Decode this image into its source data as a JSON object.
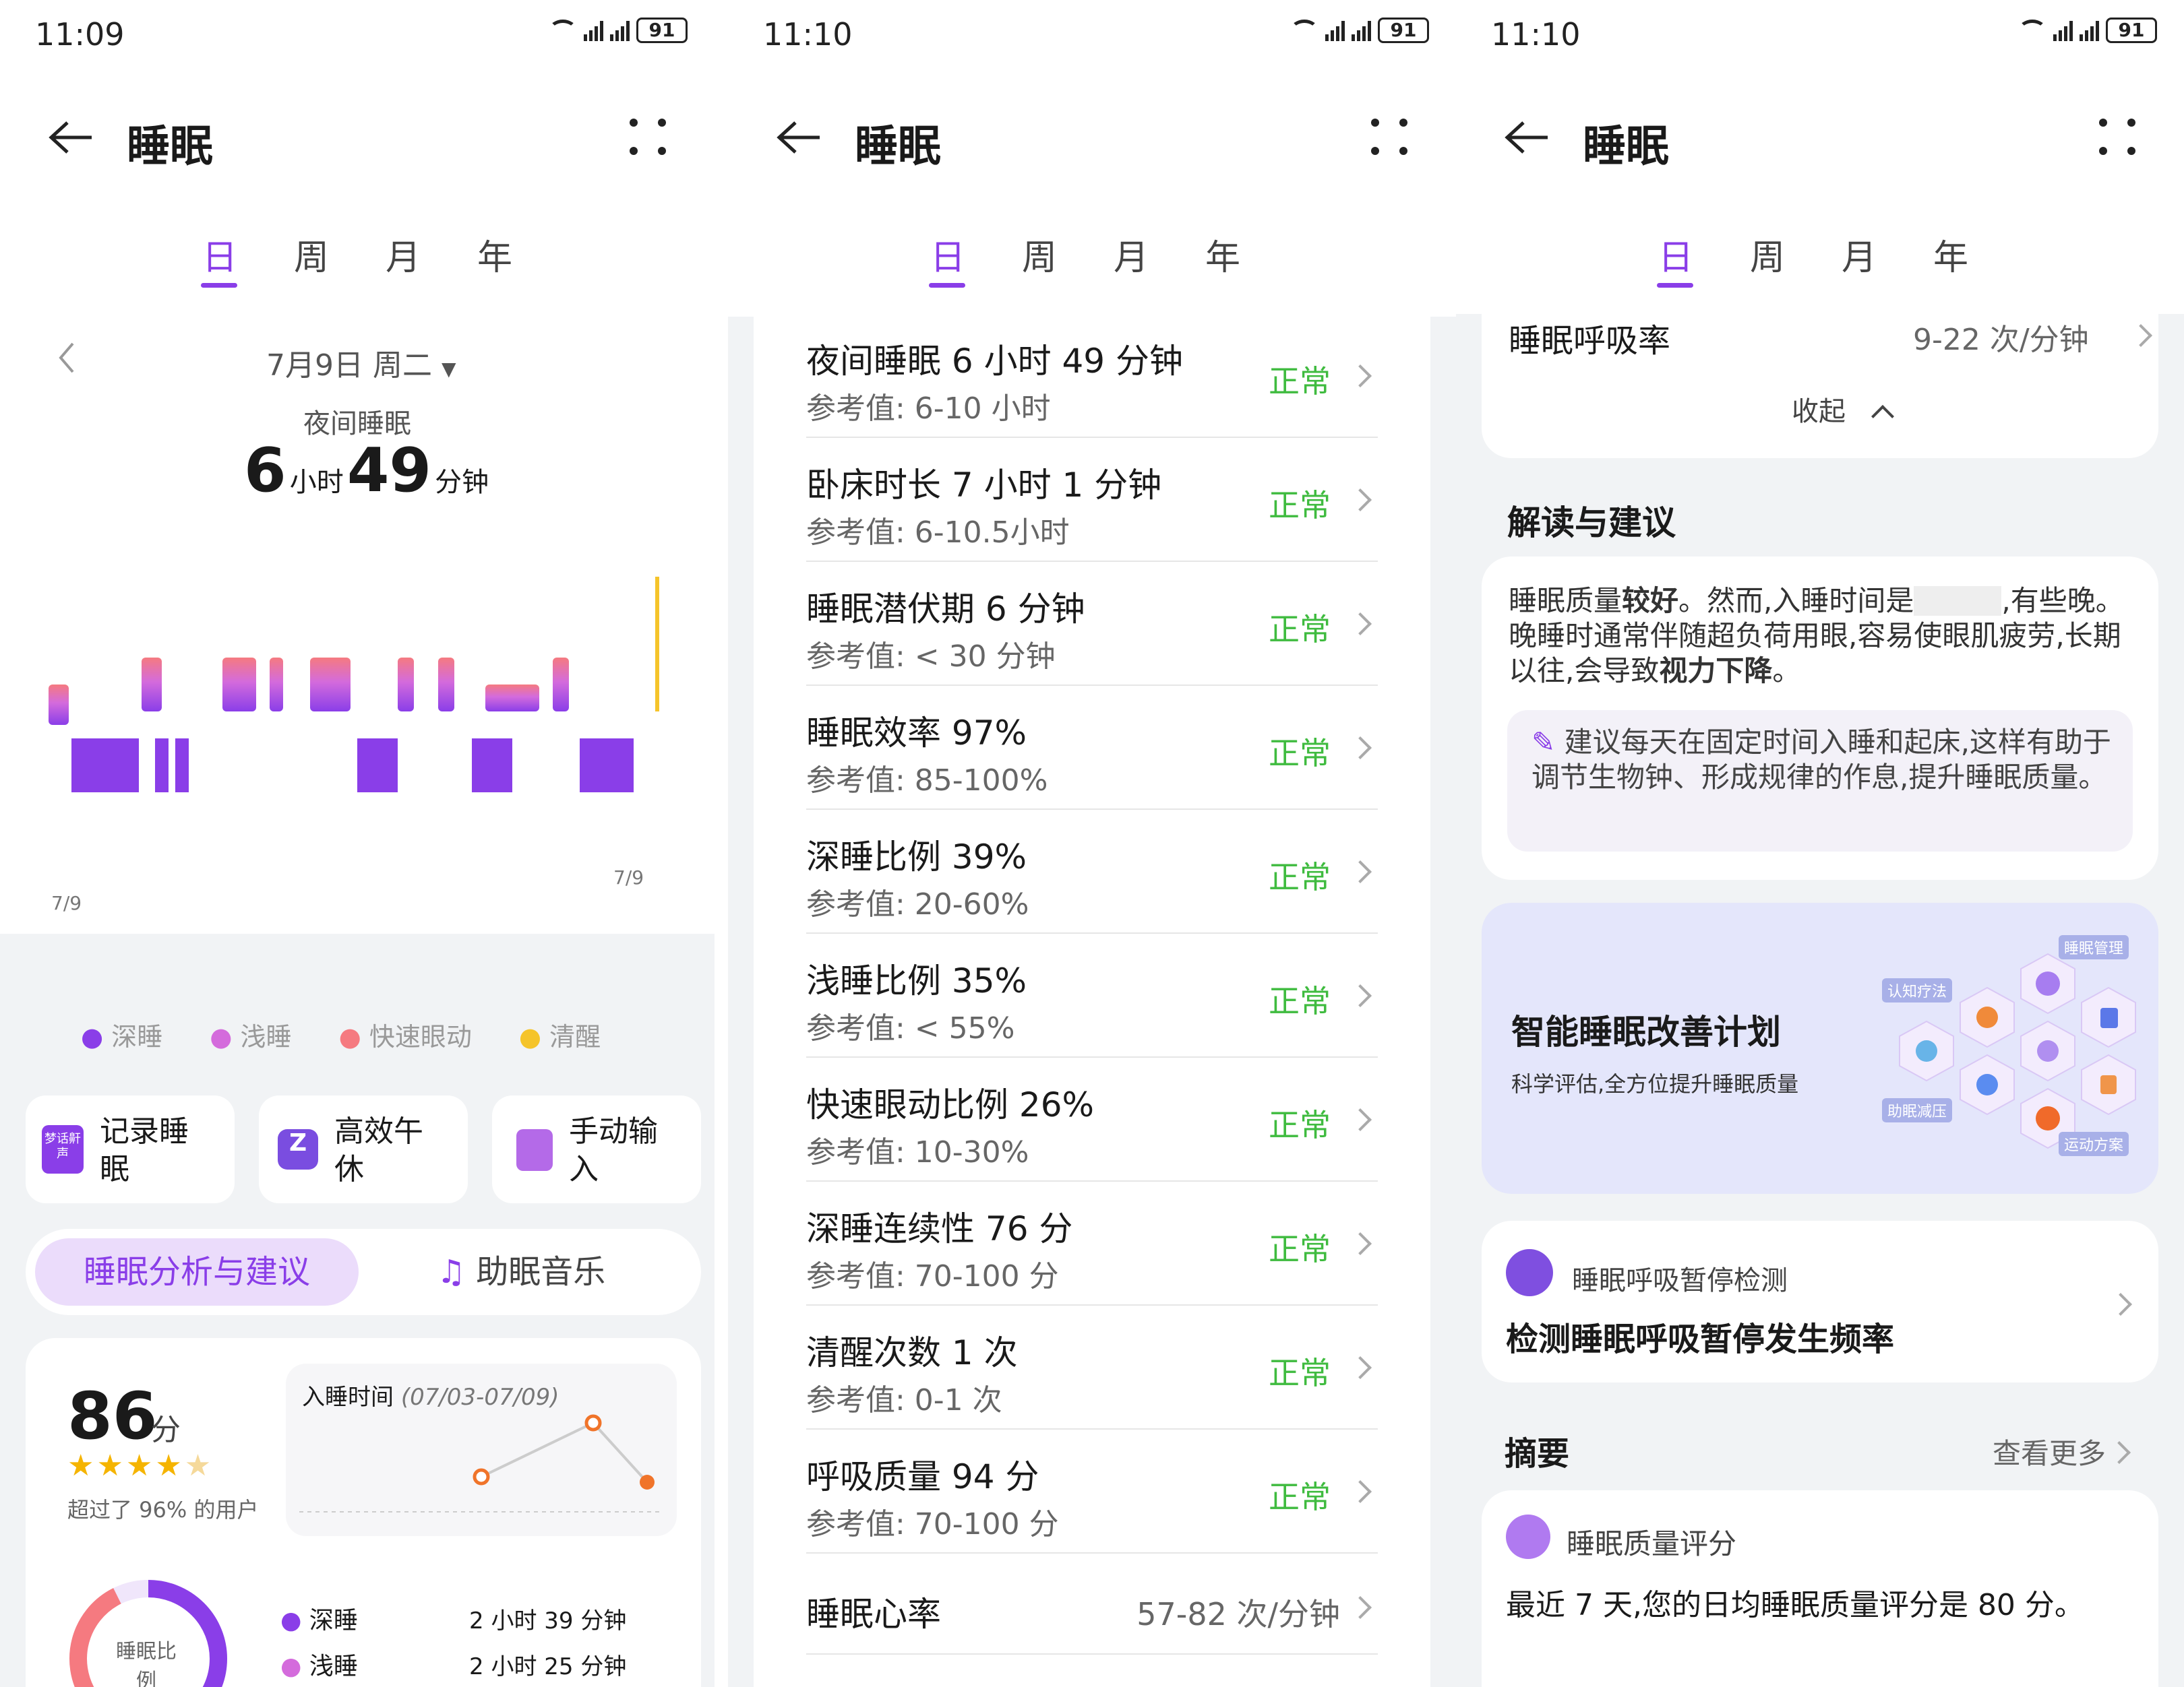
{
  "status": {
    "p1_time": "11:09",
    "p2_time": "11:10",
    "p3_time": "11:10",
    "battery": "91"
  },
  "header": {
    "title": "睡眠",
    "tabs": [
      "日",
      "周",
      "月",
      "年"
    ]
  },
  "p1": {
    "date": "7月9日 周二",
    "night_label": "夜间睡眠",
    "dur_h": "6",
    "unit_h": "小时",
    "dur_m": "49",
    "unit_m": "分钟",
    "chart_start": "7/9",
    "chart_end": "7/9",
    "legend": [
      "深睡",
      "浅睡",
      "快速眼动",
      "清醒"
    ],
    "colors": {
      "deep": "#8a3ee8",
      "light": "#d46bdc",
      "rem": "#f57a80",
      "awake": "#f5c42a"
    },
    "actions": [
      "记录睡眠",
      "高效午休",
      "手动输入"
    ],
    "action_icons": [
      "sleep-record-icon",
      "nap-icon",
      "manual-input-icon"
    ],
    "action_badge": "梦话鼾声",
    "seg_tabs": {
      "active": "睡眠分析与建议",
      "other": "助眠音乐"
    },
    "score": {
      "value": "86",
      "unit": "分",
      "rating": 4.5,
      "compare": "超过了 96% 的用户"
    },
    "fall_asleep": {
      "label": "入睡时间",
      "range": "(07/03-07/09)"
    },
    "ratio_label": "睡眠比例",
    "ratio_rows": [
      {
        "name": "深睡",
        "value": "2 小时 39 分钟"
      },
      {
        "name": "浅睡",
        "value": "2 小时 25 分钟"
      }
    ]
  },
  "p2": {
    "items": [
      {
        "name": "夜间睡眠 6 小时 49 分钟",
        "ref": "参考值: 6-10 小时",
        "status": "正常"
      },
      {
        "name": "卧床时长 7 小时 1 分钟",
        "ref": "参考值: 6-10.5小时",
        "status": "正常"
      },
      {
        "name": "睡眠潜伏期 6 分钟",
        "ref": "参考值: < 30 分钟",
        "status": "正常"
      },
      {
        "name": "睡眠效率 97%",
        "ref": "参考值: 85-100%",
        "status": "正常"
      },
      {
        "name": "深睡比例 39%",
        "ref": "参考值: 20-60%",
        "status": "正常"
      },
      {
        "name": "浅睡比例 35%",
        "ref": "参考值: < 55%",
        "status": "正常"
      },
      {
        "name": "快速眼动比例 26%",
        "ref": "参考值: 10-30%",
        "status": "正常"
      },
      {
        "name": "深睡连续性 76 分",
        "ref": "参考值: 70-100 分",
        "status": "正常"
      },
      {
        "name": "清醒次数 1 次",
        "ref": "参考值: 0-1 次",
        "status": "正常"
      },
      {
        "name": "呼吸质量 94 分",
        "ref": "参考值: 70-100 分",
        "status": "正常"
      }
    ],
    "heart": {
      "name": "睡眠心率",
      "value": "57-82 次/分钟"
    }
  },
  "p3": {
    "resp": {
      "name": "睡眠呼吸率",
      "value": "9-22 次/分钟"
    },
    "collapse": "收起",
    "advice_title": "解读与建议",
    "advice": {
      "t1": "睡眠质量",
      "b1": "较好",
      "t2": "。然而,入睡时间是",
      "t3": ",有些晚。晚睡时通常伴随超负荷用眼,容易使眼肌疲劳,长期以往,会导致",
      "b2": "视力下降",
      "t4": "。"
    },
    "tip": "建议每天在固定时间入睡和起床,这样有助于调节生物钟、形成规律的作息,提升睡眠质量。",
    "plan": {
      "title": "智能睡眠改善计划",
      "sub": "科学评估,全方位提升睡眠质量",
      "tags": [
        "睡眠管理",
        "认知疗法",
        "助眠减压",
        "运动方案"
      ]
    },
    "apnea": {
      "label": "睡眠呼吸暂停检测",
      "title": "检测睡眠呼吸暂停发生频率"
    },
    "summary": {
      "title": "摘要",
      "more": "查看更多"
    },
    "quality": {
      "label": "睡眠质量评分",
      "text": "最近 7 天,您的日均睡眠质量评分是 80 分。"
    }
  }
}
